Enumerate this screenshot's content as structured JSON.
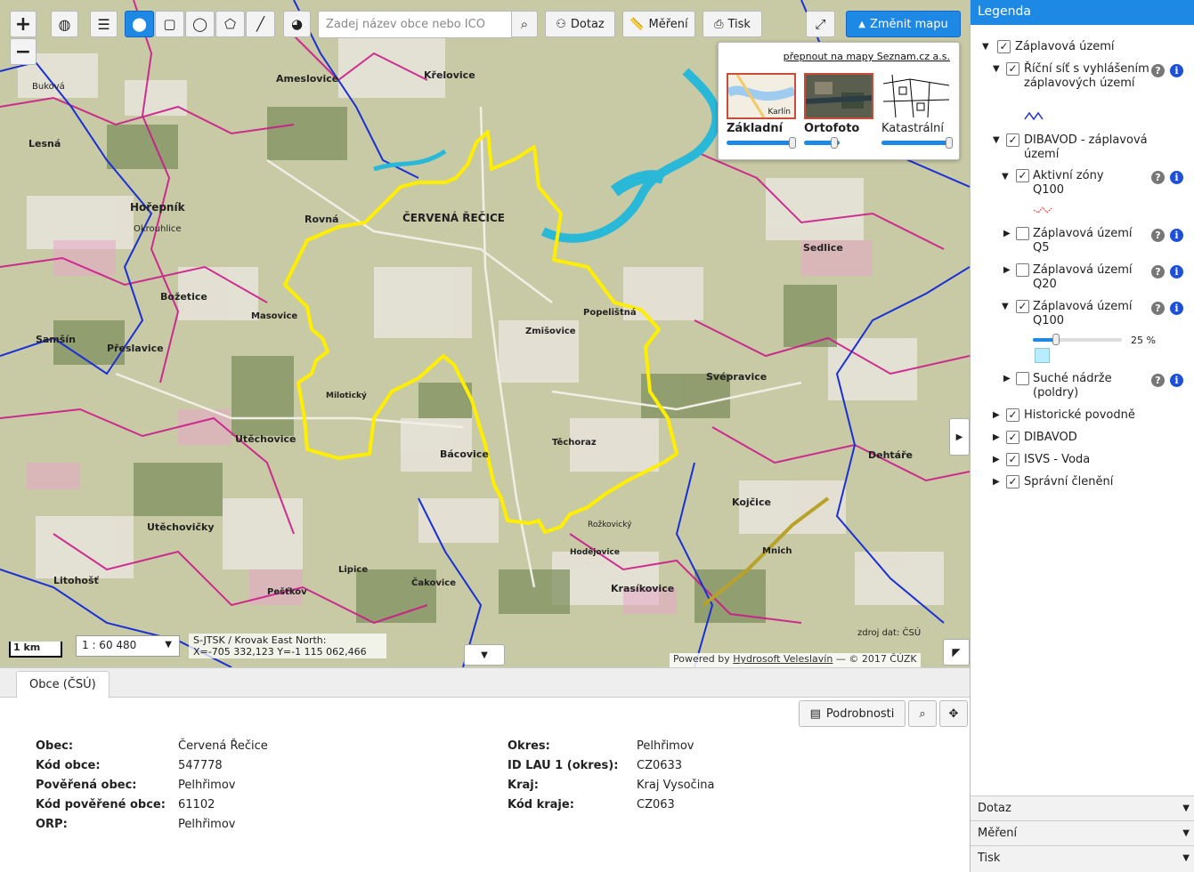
{
  "toolbar": {
    "zoom_in": "+",
    "zoom_out": "−",
    "search_placeholder": "Zadej název obce nebo ICO",
    "dotaz_label": "Dotaz",
    "mereni_label": "Měření",
    "tisk_label": "Tisk",
    "change_map_label": "Změnit mapu"
  },
  "basemap_switcher": {
    "seznam_link": "přepnout na mapy Seznam.cz a.s.",
    "options": [
      {
        "label": "Základní",
        "thumb_text": "Karlín",
        "opacity": 1.0
      },
      {
        "label": "Ortofoto",
        "opacity": 0.45
      },
      {
        "label": "Katastrální",
        "opacity": 1.0
      }
    ]
  },
  "map": {
    "scale_bar": "1 km",
    "scale_value": "1 : 60 480",
    "coords_line1": "S-JTSK / Krovak East North:",
    "coords_line2": "X=-705 332,123 Y=-1 115 062,466",
    "data_source": "zdroj dat: ČSÚ",
    "powered_prefix": "Powered by",
    "powered_link": "Hydrosoft Veleslavín",
    "powered_suffix": "— © 2017 ČÚZK",
    "place_labels": [
      "ČERVENÁ ŘEČICE",
      "Hořepník",
      "Utěchovice",
      "Bácovice",
      "Rovná",
      "Lesná",
      "Křelovice",
      "Ameslovice",
      "Sedlice",
      "Svépravice",
      "Kojčice",
      "Dehtáře",
      "Litohošť",
      "Pešťkov",
      "Samšín",
      "Přeslavice",
      "Utěchovičky",
      "Čakovice",
      "Krasíkovice",
      "Božetice",
      "Masovice",
      "Zmišovice",
      "Popelištná",
      "Těchoraz",
      "Mnich",
      "Rožkovický",
      "Hodějovice",
      "Buková",
      "Okrouhlice",
      "Milotický",
      "Lipice"
    ]
  },
  "bottom_panel": {
    "tab_label": "Obce (ČSÚ)",
    "details_button": "Podrobnosti",
    "left_fields": [
      {
        "key": "Obec",
        "value": "Červená Řečice"
      },
      {
        "key": "Kód obce",
        "value": "547778"
      },
      {
        "key": "Pověřená obec",
        "value": "Pelhřimov"
      },
      {
        "key": "Kód pověřené obce",
        "value": "61102"
      },
      {
        "key": "ORP",
        "value": "Pelhřimov"
      }
    ],
    "right_fields": [
      {
        "key": "Okres",
        "value": "Pelhřimov"
      },
      {
        "key": "ID LAU 1 (okres)",
        "value": "CZ0633"
      },
      {
        "key": "Kraj",
        "value": "Kraj Vysočina"
      },
      {
        "key": "Kód kraje",
        "value": "CZ063"
      }
    ]
  },
  "legend": {
    "title": "Legenda",
    "items": [
      {
        "label": "Záplavová území",
        "checked": true,
        "expanded": true
      },
      {
        "label": "Říční síť s vyhlášením záplavových území",
        "checked": true
      },
      {
        "label": "DIBAVOD - záplavová území",
        "checked": true,
        "expanded": true
      },
      {
        "label": "Aktivní zóny Q100",
        "checked": true,
        "expanded": true
      },
      {
        "label": "Záplavová území Q5",
        "checked": false
      },
      {
        "label": "Záplavová území Q20",
        "checked": false
      },
      {
        "label": "Záplavová území Q100",
        "checked": true,
        "expanded": true
      },
      {
        "label": "Suché nádrže (poldry)",
        "checked": false
      },
      {
        "label": "Historické povodně",
        "checked": true
      },
      {
        "label": "DIBAVOD",
        "checked": true
      },
      {
        "label": "ISVS - Voda",
        "checked": true
      },
      {
        "label": "Správní členění",
        "checked": true
      }
    ],
    "q100_opacity": "25 %",
    "accordion": [
      "Dotaz",
      "Měření",
      "Tisk"
    ]
  },
  "colors": {
    "accent": "#1e88e5",
    "boundary": "#ffee00",
    "admin_lines": "#cc1a8a",
    "water": "#1a2fd6",
    "swatch": "#b8ecff"
  }
}
